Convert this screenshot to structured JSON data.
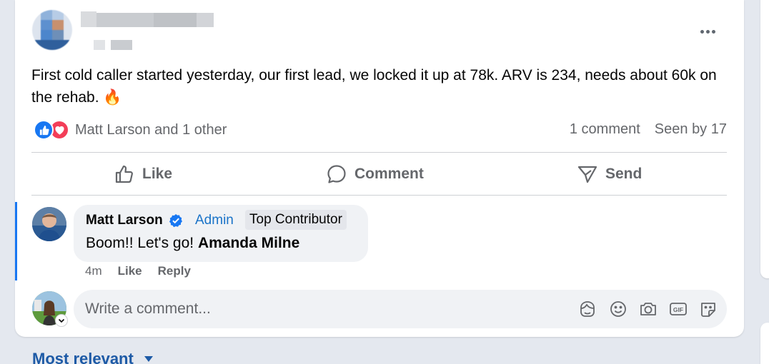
{
  "post": {
    "text": "First cold caller started yesterday, our first lead, we locked it up at 78k. ARV is 234, needs about 60k on the rehab. 🔥"
  },
  "reactions": {
    "names": "Matt Larson and 1 other",
    "comments": "1 comment",
    "seen": "Seen by 17"
  },
  "actions": {
    "like": "Like",
    "comment": "Comment",
    "send": "Send"
  },
  "comment": {
    "author": "Matt Larson",
    "role": "Admin",
    "badge": "Top Contributor",
    "text_prefix": "Boom!! Let's go!",
    "mention": "Amanda Milne",
    "time": "4m",
    "like": "Like",
    "reply": "Reply"
  },
  "composer": {
    "placeholder": "Write a comment..."
  },
  "sort": {
    "label": "Most relevant"
  },
  "colors": {
    "accent": "#1877f2",
    "love": "#f33e58",
    "muted": "#65676b",
    "link": "#1d5aa6"
  }
}
